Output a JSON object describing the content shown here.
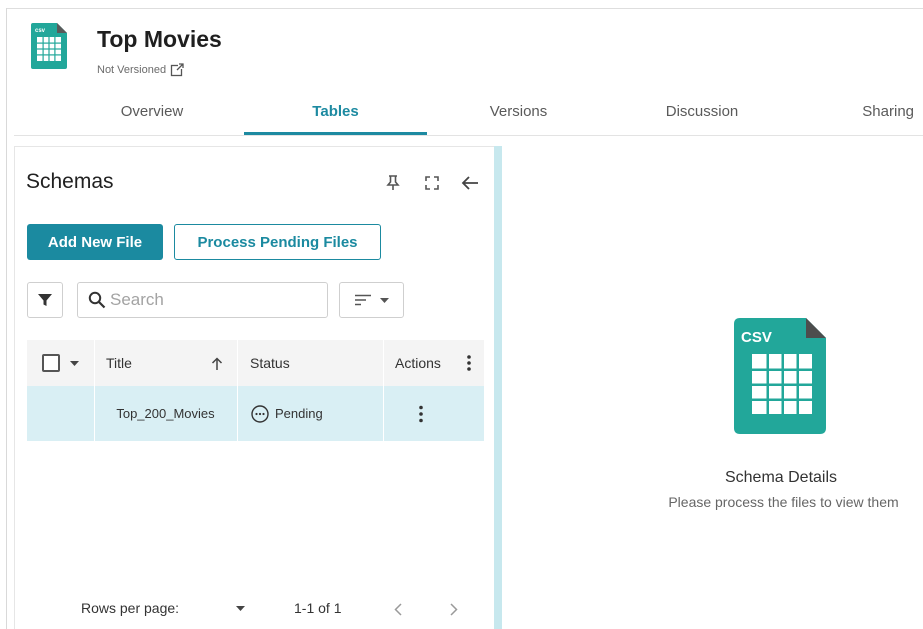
{
  "header": {
    "title": "Top Movies",
    "subtitle": "Not Versioned",
    "file_icon_label": "csv"
  },
  "tabs": [
    {
      "label": "Overview"
    },
    {
      "label": "Tables",
      "active": true
    },
    {
      "label": "Versions"
    },
    {
      "label": "Discussion"
    },
    {
      "label": "Sharing"
    }
  ],
  "schemas_panel": {
    "title": "Schemas",
    "add_button": "Add New File",
    "process_button": "Process Pending Files",
    "search_placeholder": "Search",
    "columns": {
      "title": "Title",
      "status": "Status",
      "actions": "Actions"
    },
    "rows": [
      {
        "title": "Top_200_Movies",
        "status": "Pending"
      }
    ],
    "pagination": {
      "rows_per_page_label": "Rows per page:",
      "range": "1-1 of 1"
    }
  },
  "details": {
    "icon_label": "CSV",
    "title": "Schema Details",
    "description": "Please process the files to view them"
  },
  "colors": {
    "accent": "#1b8aa0",
    "selected_row": "#d9eff4",
    "csv_green": "#22a79a"
  },
  "icons": [
    "csv-file-icon",
    "external-link-icon",
    "pin-icon",
    "fullscreen-icon",
    "arrow-back-icon",
    "filter-icon",
    "search-icon",
    "sort-icon",
    "chevron-down-icon",
    "sort-arrow-up-icon",
    "more-vert-icon",
    "pending-icon",
    "chevron-left-icon",
    "chevron-right-icon"
  ]
}
